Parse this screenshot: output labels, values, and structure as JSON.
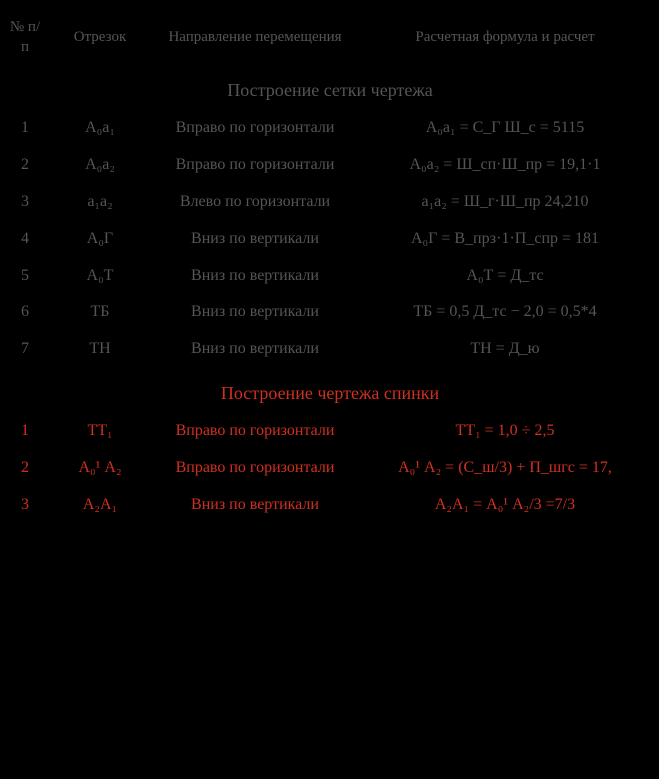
{
  "header": {
    "col_num": "№\nп/п",
    "col_segment": "Отрезок",
    "col_direction": "Направление\nперемещения",
    "col_formula": "Расчетная формула\nи расчет"
  },
  "section1": {
    "title": "Построение сетки чертежа",
    "rows": [
      {
        "num": "1",
        "segment": "А₀а₁",
        "direction": "Вправо по горизонтали",
        "formula": "А₀а₁ = С_Г  Ш_с = 5115"
      },
      {
        "num": "2",
        "segment": "А₀а₂",
        "direction": "Вправо по горизонтали",
        "formula": "А₀а₂ = Ш_сп·Ш_пр = 19,1·1"
      },
      {
        "num": "3",
        "segment": "а₁а₂",
        "direction": "Влево по горизонтали",
        "formula": "а₁а₂ = Ш_г·Ш_пр 24,210"
      },
      {
        "num": "4",
        "segment": "А₀Г",
        "direction": "Вниз по вертикали",
        "formula": "А₀Г = В_прз·1·П_спр = 181"
      },
      {
        "num": "5",
        "segment": "А₀Т",
        "direction": "Вниз по вертикали",
        "formula": "А₀Т = Д_тс"
      },
      {
        "num": "6",
        "segment": "ТБ",
        "direction": "Вниз по вертикали",
        "formula": "ТБ = 0,5 Д_тс − 2,0 = 0,5*4"
      },
      {
        "num": "7",
        "segment": "ТН",
        "direction": "Вниз по вертикали",
        "formula": "ТН = Д_ю"
      }
    ]
  },
  "section2": {
    "title": "Построение чертежа спинки",
    "rows": [
      {
        "num": "1",
        "segment": "ТТ₁",
        "direction": "Вправо по горизонтали",
        "formula": "ТТ₁ = 1,0  ÷  2,5"
      },
      {
        "num": "2",
        "segment": "А₀¹ А₂",
        "direction": "Вправо по горизонтали",
        "formula": "А₀¹ А₂ = (С_ш/3) + П_шгс = 17,"
      },
      {
        "num": "3",
        "segment": "А₂А₁",
        "direction": "Вниз по вертикали",
        "formula": "А₂А₁ = А₀¹ А₂/3 =7/3"
      }
    ]
  }
}
